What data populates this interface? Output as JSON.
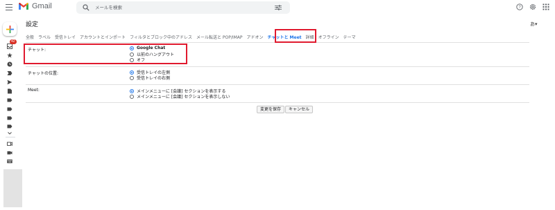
{
  "app": {
    "name": "Gmail"
  },
  "search": {
    "placeholder": "メールを検索"
  },
  "rail": {
    "badge_count": "42"
  },
  "settings": {
    "title": "設定",
    "language_button": "あ▾",
    "tabs": [
      {
        "label": "全般",
        "active": false
      },
      {
        "label": "ラベル",
        "active": false
      },
      {
        "label": "受信トレイ",
        "active": false
      },
      {
        "label": "アカウントとインポート",
        "active": false
      },
      {
        "label": "フィルタとブロック中のアドレス",
        "active": false
      },
      {
        "label": "メール転送と POP/IMAP",
        "active": false
      },
      {
        "label": "アドオン",
        "active": false
      },
      {
        "label": "チャットと Meet",
        "active": true
      },
      {
        "label": "詳細",
        "active": false
      },
      {
        "label": "オフライン",
        "active": false
      },
      {
        "label": "テーマ",
        "active": false
      }
    ],
    "chat": {
      "label": "チャット:",
      "options": [
        {
          "text": "Google Chat",
          "checked": true
        },
        {
          "text": "以前のハングアウト",
          "checked": false
        },
        {
          "text": "オフ",
          "checked": false
        }
      ]
    },
    "chat_position": {
      "label": "チャットの位置:",
      "options": [
        {
          "text": "受信トレイの左側",
          "checked": true
        },
        {
          "text": "受信トレイの右側",
          "checked": false
        }
      ]
    },
    "meet": {
      "label": "Meet:",
      "options": [
        {
          "text": "メインメニューに [会議] セクションを表示する",
          "checked": true
        },
        {
          "text": "メインメニューに [会議] セクションを表示しない",
          "checked": false
        }
      ]
    },
    "buttons": {
      "save": "変更を保存",
      "cancel": "キャンセル"
    }
  },
  "colors": {
    "accent": "#1a73e8",
    "highlight": "#e0192e",
    "badge": "#d93025"
  }
}
